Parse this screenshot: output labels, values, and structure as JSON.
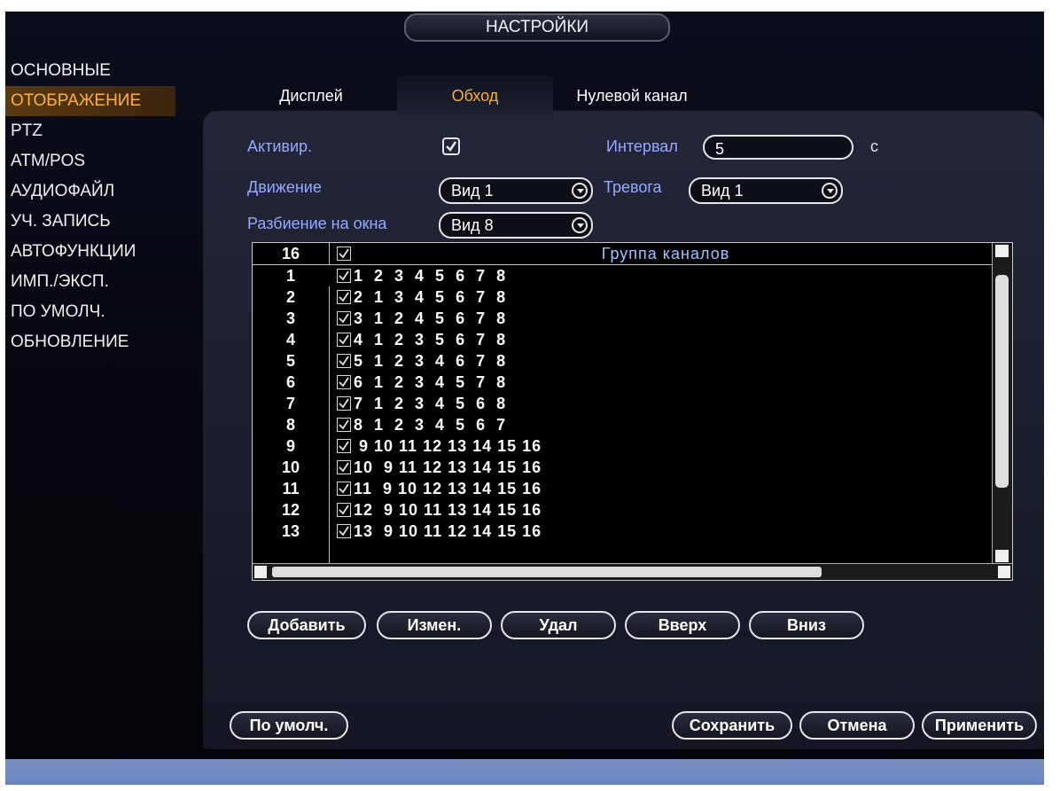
{
  "title": "НАСТРОЙКИ",
  "sidebar": {
    "items": [
      {
        "label": "ОСНОВНЫЕ"
      },
      {
        "label": "ОТОБРАЖЕНИЕ"
      },
      {
        "label": "PTZ"
      },
      {
        "label": "ATM/POS"
      },
      {
        "label": "АУДИОФАЙЛ"
      },
      {
        "label": "УЧ. ЗАПИСЬ"
      },
      {
        "label": "АВТОФУНКЦИИ"
      },
      {
        "label": "ИМП./ЭКСП."
      },
      {
        "label": "ПО УМОЛЧ."
      },
      {
        "label": "ОБНОВЛЕНИЕ"
      }
    ],
    "active_index": 1
  },
  "tabs": [
    {
      "label": "Дисплей"
    },
    {
      "label": "Обход"
    },
    {
      "label": "Нулевой канал"
    }
  ],
  "form": {
    "activate_label": "Активир.",
    "activate_checked": true,
    "interval_label": "Интервал",
    "interval_value": "5",
    "interval_unit": "с",
    "motion_label": "Движение",
    "motion_value": "Вид 1",
    "alarm_label": "Тревога",
    "alarm_value": "Вид 1",
    "split_label": "Разбиение на окна",
    "split_value": "Вид 8"
  },
  "table": {
    "header_count": "16",
    "header_title": "Группа каналов",
    "rows": [
      {
        "num": "1",
        "channels": "1  2  3  4  5  6  7  8"
      },
      {
        "num": "2",
        "channels": "2  1  3  4  5  6  7  8"
      },
      {
        "num": "3",
        "channels": "3  1  2  4  5  6  7  8"
      },
      {
        "num": "4",
        "channels": "4  1  2  3  5  6  7  8"
      },
      {
        "num": "5",
        "channels": "5  1  2  3  4  6  7  8"
      },
      {
        "num": "6",
        "channels": "6  1  2  3  4  5  7  8"
      },
      {
        "num": "7",
        "channels": "7  1  2  3  4  5  6  8"
      },
      {
        "num": "8",
        "channels": "8  1  2  3  4  5  6  7"
      },
      {
        "num": "9",
        "channels": " 9 10 11 12 13 14 15 16"
      },
      {
        "num": "10",
        "channels": "10  9 11 12 13 14 15 16"
      },
      {
        "num": "11",
        "channels": "11  9 10 12 13 14 15 16"
      },
      {
        "num": "12",
        "channels": "12  9 10 11 13 14 15 16"
      },
      {
        "num": "13",
        "channels": "13  9 10 11 12 14 15 16"
      }
    ]
  },
  "actions": {
    "add": "Добавить",
    "edit": "Измен.",
    "delete": "Удал",
    "up": "Вверх",
    "down": "Вниз"
  },
  "footer": {
    "default": "По умолч.",
    "save": "Сохранить",
    "cancel": "Отмена",
    "apply": "Применить"
  },
  "colors": {
    "accent": "#ffb02e",
    "label_blue": "#98a8ff",
    "panel": "#1e2232"
  }
}
